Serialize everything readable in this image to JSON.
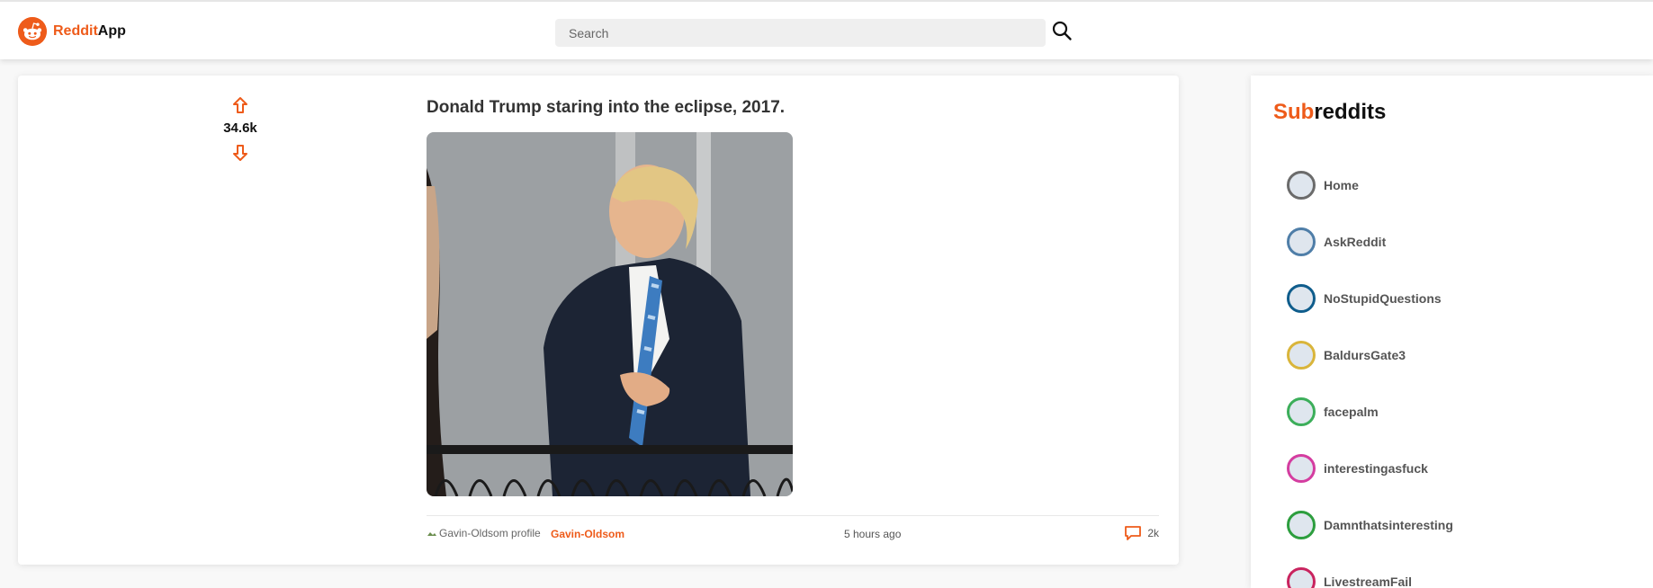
{
  "header": {
    "brand_accent": "Reddit",
    "brand_rest": "App",
    "search_placeholder": "Search"
  },
  "post": {
    "votes": "34.6k",
    "title": "Donald Trump staring into the eclipse, 2017.",
    "author_avatar_alt": "Gavin-Oldsom profile",
    "author": "Gavin-Oldsom",
    "time": "5 hours ago",
    "comments": "2k"
  },
  "sidebar": {
    "title_accent": "Sub",
    "title_rest": "reddits",
    "items": [
      {
        "label": "Home",
        "icon": "home-icon",
        "ring": "#6b6b6b"
      },
      {
        "label": "AskReddit",
        "icon": "snoo-icon",
        "ring": "#4f7ea8"
      },
      {
        "label": "NoStupidQuestions",
        "icon": "question-icon",
        "ring": "#0f5d8c"
      },
      {
        "label": "BaldursGate3",
        "icon": "subreddit-icon",
        "ring": "#d9b53b"
      },
      {
        "label": "facepalm",
        "icon": "facepalm-icon",
        "ring": "#3cae5a"
      },
      {
        "label": "interestingasfuck",
        "icon": "subreddit-icon",
        "ring": "#d43da0"
      },
      {
        "label": "Damnthatsinteresting",
        "icon": "subreddit-icon",
        "ring": "#2d9e3e"
      },
      {
        "label": "LivestreamFail",
        "icon": "subreddit-icon",
        "ring": "#c9245f"
      }
    ]
  },
  "colors": {
    "accent": "#ee5b1a"
  }
}
